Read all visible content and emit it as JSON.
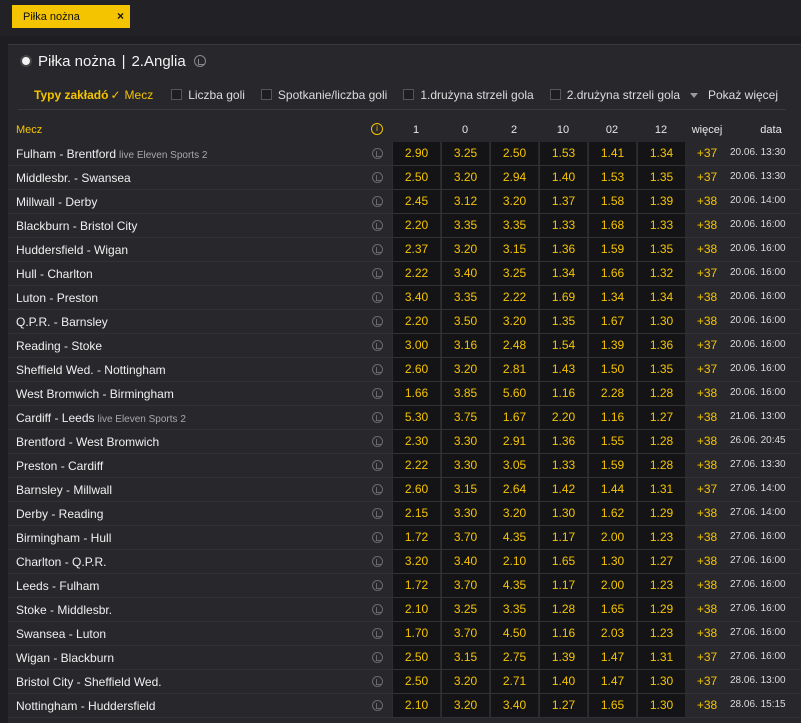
{
  "chip": {
    "label": "Piłka nożna",
    "close": "×"
  },
  "header": {
    "sport": "Piłka nożna",
    "separator": "|",
    "league": "2.Anglia"
  },
  "filter": {
    "label": "Typy zakładó",
    "check": "✓",
    "selected": "Mecz",
    "options": [
      "Liczba goli",
      "Spotkanie/liczba goli",
      "1.drużyna strzeli gola",
      "2.drużyna strzeli gola"
    ],
    "more": "Pokaż więcej"
  },
  "columns": {
    "mecz": "Mecz",
    "info": "i",
    "odds": [
      "1",
      "0",
      "2",
      "10",
      "02",
      "12"
    ],
    "more": "więcej",
    "date": "data"
  },
  "matches": [
    {
      "name": "Fulham - Brentford",
      "live": "live Eleven Sports 2",
      "odds": [
        "2.90",
        "3.25",
        "2.50",
        "1.53",
        "1.41",
        "1.34"
      ],
      "more": "+37",
      "date": "20.06. 13:30"
    },
    {
      "name": "Middlesbr. - Swansea",
      "live": "",
      "odds": [
        "2.50",
        "3.20",
        "2.94",
        "1.40",
        "1.53",
        "1.35"
      ],
      "more": "+37",
      "date": "20.06. 13:30"
    },
    {
      "name": "Millwall - Derby",
      "live": "",
      "odds": [
        "2.45",
        "3.12",
        "3.20",
        "1.37",
        "1.58",
        "1.39"
      ],
      "more": "+38",
      "date": "20.06. 14:00"
    },
    {
      "name": "Blackburn - Bristol City",
      "live": "",
      "odds": [
        "2.20",
        "3.35",
        "3.35",
        "1.33",
        "1.68",
        "1.33"
      ],
      "more": "+38",
      "date": "20.06. 16:00"
    },
    {
      "name": "Huddersfield - Wigan",
      "live": "",
      "odds": [
        "2.37",
        "3.20",
        "3.15",
        "1.36",
        "1.59",
        "1.35"
      ],
      "more": "+38",
      "date": "20.06. 16:00"
    },
    {
      "name": "Hull - Charlton",
      "live": "",
      "odds": [
        "2.22",
        "3.40",
        "3.25",
        "1.34",
        "1.66",
        "1.32"
      ],
      "more": "+37",
      "date": "20.06. 16:00"
    },
    {
      "name": "Luton - Preston",
      "live": "",
      "odds": [
        "3.40",
        "3.35",
        "2.22",
        "1.69",
        "1.34",
        "1.34"
      ],
      "more": "+38",
      "date": "20.06. 16:00"
    },
    {
      "name": "Q.P.R. - Barnsley",
      "live": "",
      "odds": [
        "2.20",
        "3.50",
        "3.20",
        "1.35",
        "1.67",
        "1.30"
      ],
      "more": "+38",
      "date": "20.06. 16:00"
    },
    {
      "name": "Reading - Stoke",
      "live": "",
      "odds": [
        "3.00",
        "3.16",
        "2.48",
        "1.54",
        "1.39",
        "1.36"
      ],
      "more": "+37",
      "date": "20.06. 16:00"
    },
    {
      "name": "Sheffield Wed. - Nottingham",
      "live": "",
      "odds": [
        "2.60",
        "3.20",
        "2.81",
        "1.43",
        "1.50",
        "1.35"
      ],
      "more": "+37",
      "date": "20.06. 16:00"
    },
    {
      "name": "West Bromwich - Birmingham",
      "live": "",
      "odds": [
        "1.66",
        "3.85",
        "5.60",
        "1.16",
        "2.28",
        "1.28"
      ],
      "more": "+38",
      "date": "20.06. 16:00"
    },
    {
      "name": "Cardiff - Leeds",
      "live": "live Eleven Sports 2",
      "odds": [
        "5.30",
        "3.75",
        "1.67",
        "2.20",
        "1.16",
        "1.27"
      ],
      "more": "+38",
      "date": "21.06. 13:00"
    },
    {
      "name": "Brentford - West Bromwich",
      "live": "",
      "odds": [
        "2.30",
        "3.30",
        "2.91",
        "1.36",
        "1.55",
        "1.28"
      ],
      "more": "+38",
      "date": "26.06. 20:45"
    },
    {
      "name": "Preston - Cardiff",
      "live": "",
      "odds": [
        "2.22",
        "3.30",
        "3.05",
        "1.33",
        "1.59",
        "1.28"
      ],
      "more": "+38",
      "date": "27.06. 13:30"
    },
    {
      "name": "Barnsley - Millwall",
      "live": "",
      "odds": [
        "2.60",
        "3.15",
        "2.64",
        "1.42",
        "1.44",
        "1.31"
      ],
      "more": "+37",
      "date": "27.06. 14:00"
    },
    {
      "name": "Derby - Reading",
      "live": "",
      "odds": [
        "2.15",
        "3.30",
        "3.20",
        "1.30",
        "1.62",
        "1.29"
      ],
      "more": "+38",
      "date": "27.06. 14:00"
    },
    {
      "name": "Birmingham - Hull",
      "live": "",
      "odds": [
        "1.72",
        "3.70",
        "4.35",
        "1.17",
        "2.00",
        "1.23"
      ],
      "more": "+38",
      "date": "27.06. 16:00"
    },
    {
      "name": "Charlton - Q.P.R.",
      "live": "",
      "odds": [
        "3.20",
        "3.40",
        "2.10",
        "1.65",
        "1.30",
        "1.27"
      ],
      "more": "+38",
      "date": "27.06. 16:00"
    },
    {
      "name": "Leeds - Fulham",
      "live": "",
      "odds": [
        "1.72",
        "3.70",
        "4.35",
        "1.17",
        "2.00",
        "1.23"
      ],
      "more": "+38",
      "date": "27.06. 16:00"
    },
    {
      "name": "Stoke - Middlesbr.",
      "live": "",
      "odds": [
        "2.10",
        "3.25",
        "3.35",
        "1.28",
        "1.65",
        "1.29"
      ],
      "more": "+38",
      "date": "27.06. 16:00"
    },
    {
      "name": "Swansea - Luton",
      "live": "",
      "odds": [
        "1.70",
        "3.70",
        "4.50",
        "1.16",
        "2.03",
        "1.23"
      ],
      "more": "+38",
      "date": "27.06. 16:00"
    },
    {
      "name": "Wigan - Blackburn",
      "live": "",
      "odds": [
        "2.50",
        "3.15",
        "2.75",
        "1.39",
        "1.47",
        "1.31"
      ],
      "more": "+37",
      "date": "27.06. 16:00"
    },
    {
      "name": "Bristol City - Sheffield Wed.",
      "live": "",
      "odds": [
        "2.50",
        "3.20",
        "2.71",
        "1.40",
        "1.47",
        "1.30"
      ],
      "more": "+37",
      "date": "28.06. 13:00"
    },
    {
      "name": "Nottingham - Huddersfield",
      "live": "",
      "odds": [
        "2.10",
        "3.20",
        "3.40",
        "1.27",
        "1.65",
        "1.30"
      ],
      "more": "+38",
      "date": "28.06. 15:15"
    }
  ],
  "colors": {
    "accent": "#f5c400",
    "background": "#1e1e22",
    "panel": "#28282c",
    "odds_cell": "#141416"
  }
}
